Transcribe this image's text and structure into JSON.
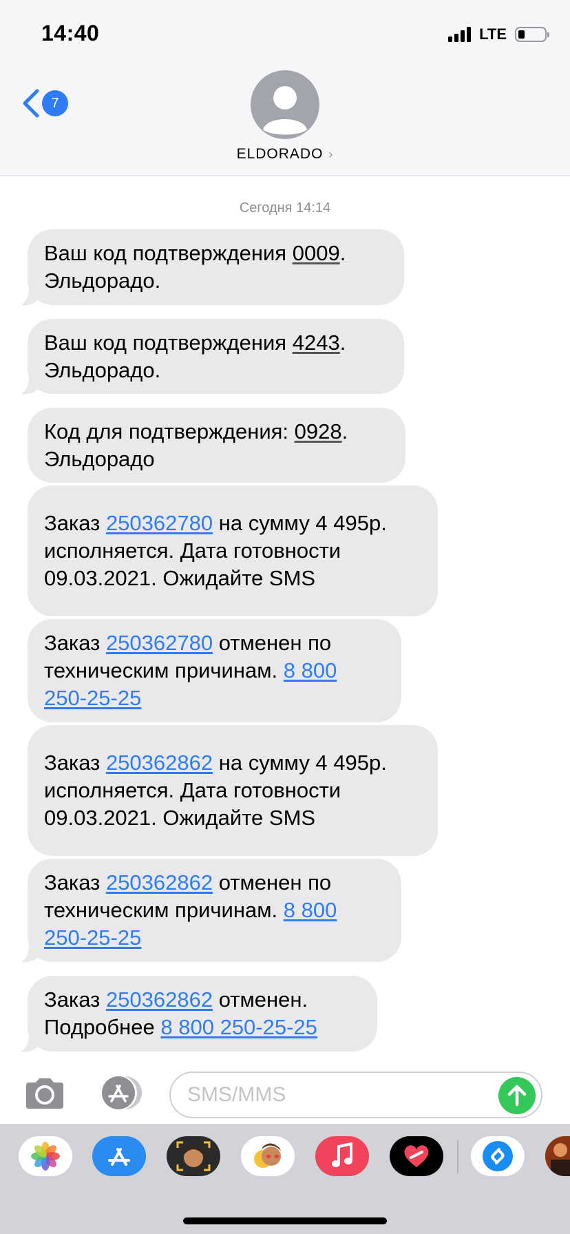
{
  "status_bar": {
    "time": "14:40",
    "network": "LTE"
  },
  "header": {
    "back_badge": "7",
    "contact_name": "ELDORADO",
    "contact_chevron": "›"
  },
  "thread": {
    "date_label": "Сегодня 14:14",
    "messages": [
      [
        {
          "t": "Ваш код подтверждения "
        },
        {
          "t": "0009",
          "k": "code"
        },
        {
          "t": ". Эльдорадо."
        }
      ],
      [
        {
          "t": "Ваш код подтверждения "
        },
        {
          "t": "4243",
          "k": "code"
        },
        {
          "t": ". Эльдорадо."
        }
      ],
      [
        {
          "t": "Код для подтверждения: "
        },
        {
          "t": "0928",
          "k": "code"
        },
        {
          "t": ". Эльдорадо"
        }
      ],
      [
        {
          "t": "Заказ "
        },
        {
          "t": "250362780",
          "k": "link"
        },
        {
          "t": " на сумму 4 495р. исполняется. Дата готовности 09.03.2021. Ожидайте SMS"
        }
      ],
      [
        {
          "t": "Заказ "
        },
        {
          "t": "250362780",
          "k": "link"
        },
        {
          "t": " отменен по техническим причинам. "
        },
        {
          "t": "8 800 250-25-25",
          "k": "link"
        }
      ],
      [
        {
          "t": "Заказ "
        },
        {
          "t": "250362862",
          "k": "link"
        },
        {
          "t": " на сумму 4 495р. исполняется. Дата готовности 09.03.2021. Ожидайте SMS"
        }
      ],
      [
        {
          "t": "Заказ "
        },
        {
          "t": "250362862",
          "k": "link"
        },
        {
          "t": " отменен по техническим причинам. "
        },
        {
          "t": "8 800 250-25-25",
          "k": "link"
        }
      ],
      [
        {
          "t": "Заказ "
        },
        {
          "t": "250362862",
          "k": "link"
        },
        {
          "t": " отменен. Подробнее "
        },
        {
          "t": "8 800 250-25-25",
          "k": "link"
        }
      ]
    ]
  },
  "composer": {
    "placeholder": "SMS/MMS"
  },
  "app_drawer": {
    "apps": [
      "photos-icon",
      "app-store-icon",
      "memoji-icon",
      "animoji-icon",
      "music-icon",
      "digital-touch-icon",
      "shazam-icon",
      "game-icon"
    ]
  },
  "colors": {
    "link": "#2f7cf6",
    "bubble": "#e9e9eb",
    "send": "#34c759",
    "header_bg": "#f6f6f8",
    "drawer_bg": "#d1d3d9"
  }
}
